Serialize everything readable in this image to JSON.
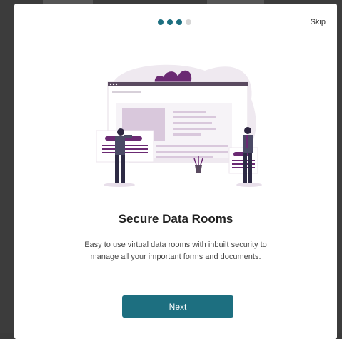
{
  "onboarding": {
    "skip_label": "Skip",
    "title": "Secure Data Rooms",
    "description": "Easy to use virtual data rooms with inbuilt security to manage all your important forms and documents.",
    "next_label": "Next",
    "progress": {
      "current_step": 3,
      "total_steps": 4
    }
  },
  "colors": {
    "accent": "#1d6f80",
    "illustration_purple": "#6b2a73",
    "illustration_lavender": "#e8dfea"
  },
  "icons": [
    "people-at-browser-illustration"
  ]
}
